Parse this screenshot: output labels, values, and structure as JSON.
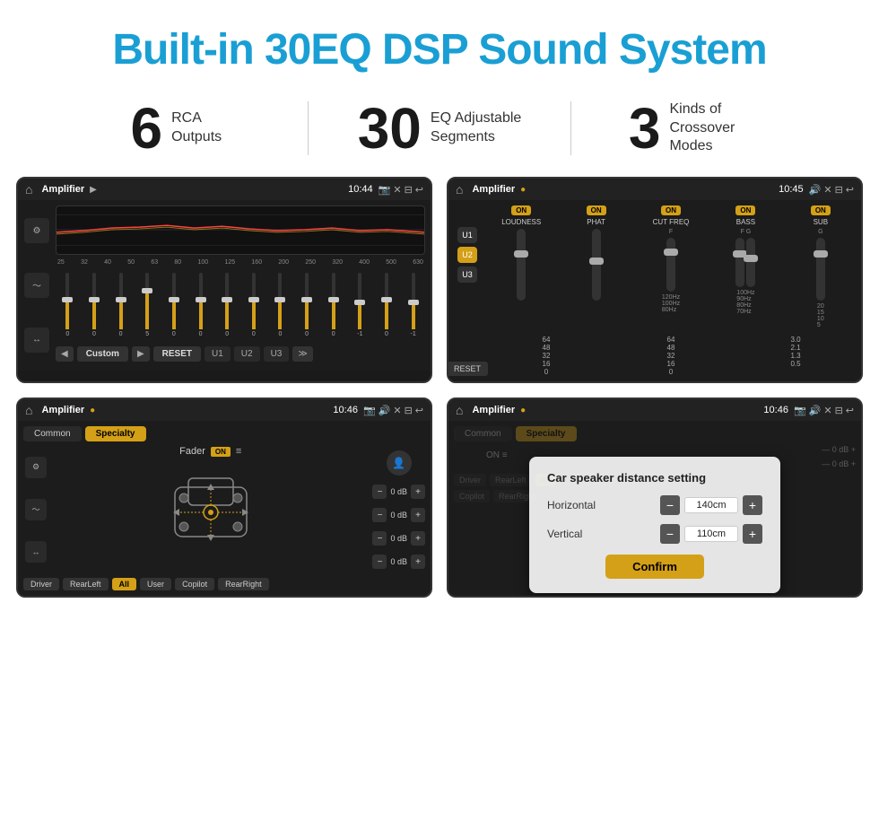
{
  "header": {
    "title": "Built-in 30EQ DSP Sound System"
  },
  "stats": [
    {
      "number": "6",
      "text": "RCA\nOutputs"
    },
    {
      "number": "30",
      "text": "EQ Adjustable\nSegments"
    },
    {
      "number": "3",
      "text": "Kinds of\nCrossover Modes"
    }
  ],
  "screens": {
    "eq": {
      "title": "Amplifier",
      "time": "10:44",
      "freqs": [
        "25",
        "32",
        "40",
        "50",
        "63",
        "80",
        "100",
        "125",
        "160",
        "200",
        "250",
        "320",
        "400",
        "500",
        "630"
      ],
      "values": [
        "0",
        "0",
        "0",
        "5",
        "0",
        "0",
        "0",
        "0",
        "0",
        "0",
        "0",
        "-1",
        "0",
        "-1"
      ],
      "mode_label": "Custom",
      "buttons": [
        "RESET",
        "U1",
        "U2",
        "U3"
      ]
    },
    "dsp": {
      "title": "Amplifier",
      "time": "10:45",
      "units": [
        "U1",
        "U2",
        "U3"
      ],
      "controls": [
        "LOUDNESS",
        "PHAT",
        "CUT FREQ",
        "BASS",
        "SUB"
      ],
      "reset_label": "RESET"
    },
    "fader": {
      "title": "Amplifier",
      "time": "10:46",
      "tabs": [
        "Common",
        "Specialty"
      ],
      "fader_label": "Fader",
      "on_label": "ON",
      "presets": [
        "Driver",
        "RearLeft",
        "All",
        "User",
        "Copilot",
        "RearRight"
      ],
      "vol_values": [
        "0 dB",
        "0 dB",
        "0 dB",
        "0 dB"
      ]
    },
    "distance": {
      "title": "Amplifier",
      "time": "10:46",
      "overlay_title": "Car speaker distance setting",
      "horizontal_label": "Horizontal",
      "horizontal_value": "140cm",
      "vertical_label": "Vertical",
      "vertical_value": "110cm",
      "confirm_label": "Confirm"
    }
  }
}
